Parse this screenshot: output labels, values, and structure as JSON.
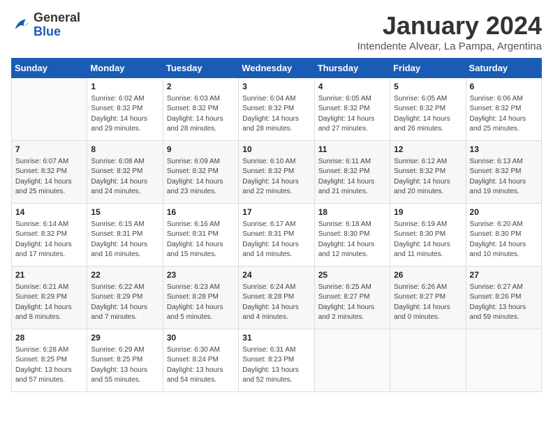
{
  "logo": {
    "general": "General",
    "blue": "Blue"
  },
  "header": {
    "title": "January 2024",
    "subtitle": "Intendente Alvear, La Pampa, Argentina"
  },
  "columns": [
    "Sunday",
    "Monday",
    "Tuesday",
    "Wednesday",
    "Thursday",
    "Friday",
    "Saturday"
  ],
  "weeks": [
    [
      {
        "day": "",
        "sunrise": "",
        "sunset": "",
        "daylight": ""
      },
      {
        "day": "1",
        "sunrise": "Sunrise: 6:02 AM",
        "sunset": "Sunset: 8:32 PM",
        "daylight": "Daylight: 14 hours and 29 minutes."
      },
      {
        "day": "2",
        "sunrise": "Sunrise: 6:03 AM",
        "sunset": "Sunset: 8:32 PM",
        "daylight": "Daylight: 14 hours and 28 minutes."
      },
      {
        "day": "3",
        "sunrise": "Sunrise: 6:04 AM",
        "sunset": "Sunset: 8:32 PM",
        "daylight": "Daylight: 14 hours and 28 minutes."
      },
      {
        "day": "4",
        "sunrise": "Sunrise: 6:05 AM",
        "sunset": "Sunset: 8:32 PM",
        "daylight": "Daylight: 14 hours and 27 minutes."
      },
      {
        "day": "5",
        "sunrise": "Sunrise: 6:05 AM",
        "sunset": "Sunset: 8:32 PM",
        "daylight": "Daylight: 14 hours and 26 minutes."
      },
      {
        "day": "6",
        "sunrise": "Sunrise: 6:06 AM",
        "sunset": "Sunset: 8:32 PM",
        "daylight": "Daylight: 14 hours and 25 minutes."
      }
    ],
    [
      {
        "day": "7",
        "sunrise": "Sunrise: 6:07 AM",
        "sunset": "Sunset: 8:32 PM",
        "daylight": "Daylight: 14 hours and 25 minutes."
      },
      {
        "day": "8",
        "sunrise": "Sunrise: 6:08 AM",
        "sunset": "Sunset: 8:32 PM",
        "daylight": "Daylight: 14 hours and 24 minutes."
      },
      {
        "day": "9",
        "sunrise": "Sunrise: 6:09 AM",
        "sunset": "Sunset: 8:32 PM",
        "daylight": "Daylight: 14 hours and 23 minutes."
      },
      {
        "day": "10",
        "sunrise": "Sunrise: 6:10 AM",
        "sunset": "Sunset: 8:32 PM",
        "daylight": "Daylight: 14 hours and 22 minutes."
      },
      {
        "day": "11",
        "sunrise": "Sunrise: 6:11 AM",
        "sunset": "Sunset: 8:32 PM",
        "daylight": "Daylight: 14 hours and 21 minutes."
      },
      {
        "day": "12",
        "sunrise": "Sunrise: 6:12 AM",
        "sunset": "Sunset: 8:32 PM",
        "daylight": "Daylight: 14 hours and 20 minutes."
      },
      {
        "day": "13",
        "sunrise": "Sunrise: 6:13 AM",
        "sunset": "Sunset: 8:32 PM",
        "daylight": "Daylight: 14 hours and 19 minutes."
      }
    ],
    [
      {
        "day": "14",
        "sunrise": "Sunrise: 6:14 AM",
        "sunset": "Sunset: 8:32 PM",
        "daylight": "Daylight: 14 hours and 17 minutes."
      },
      {
        "day": "15",
        "sunrise": "Sunrise: 6:15 AM",
        "sunset": "Sunset: 8:31 PM",
        "daylight": "Daylight: 14 hours and 16 minutes."
      },
      {
        "day": "16",
        "sunrise": "Sunrise: 6:16 AM",
        "sunset": "Sunset: 8:31 PM",
        "daylight": "Daylight: 14 hours and 15 minutes."
      },
      {
        "day": "17",
        "sunrise": "Sunrise: 6:17 AM",
        "sunset": "Sunset: 8:31 PM",
        "daylight": "Daylight: 14 hours and 14 minutes."
      },
      {
        "day": "18",
        "sunrise": "Sunrise: 6:18 AM",
        "sunset": "Sunset: 8:30 PM",
        "daylight": "Daylight: 14 hours and 12 minutes."
      },
      {
        "day": "19",
        "sunrise": "Sunrise: 6:19 AM",
        "sunset": "Sunset: 8:30 PM",
        "daylight": "Daylight: 14 hours and 11 minutes."
      },
      {
        "day": "20",
        "sunrise": "Sunrise: 6:20 AM",
        "sunset": "Sunset: 8:30 PM",
        "daylight": "Daylight: 14 hours and 10 minutes."
      }
    ],
    [
      {
        "day": "21",
        "sunrise": "Sunrise: 6:21 AM",
        "sunset": "Sunset: 8:29 PM",
        "daylight": "Daylight: 14 hours and 8 minutes."
      },
      {
        "day": "22",
        "sunrise": "Sunrise: 6:22 AM",
        "sunset": "Sunset: 8:29 PM",
        "daylight": "Daylight: 14 hours and 7 minutes."
      },
      {
        "day": "23",
        "sunrise": "Sunrise: 6:23 AM",
        "sunset": "Sunset: 8:28 PM",
        "daylight": "Daylight: 14 hours and 5 minutes."
      },
      {
        "day": "24",
        "sunrise": "Sunrise: 6:24 AM",
        "sunset": "Sunset: 8:28 PM",
        "daylight": "Daylight: 14 hours and 4 minutes."
      },
      {
        "day": "25",
        "sunrise": "Sunrise: 6:25 AM",
        "sunset": "Sunset: 8:27 PM",
        "daylight": "Daylight: 14 hours and 2 minutes."
      },
      {
        "day": "26",
        "sunrise": "Sunrise: 6:26 AM",
        "sunset": "Sunset: 8:27 PM",
        "daylight": "Daylight: 14 hours and 0 minutes."
      },
      {
        "day": "27",
        "sunrise": "Sunrise: 6:27 AM",
        "sunset": "Sunset: 8:26 PM",
        "daylight": "Daylight: 13 hours and 59 minutes."
      }
    ],
    [
      {
        "day": "28",
        "sunrise": "Sunrise: 6:28 AM",
        "sunset": "Sunset: 8:25 PM",
        "daylight": "Daylight: 13 hours and 57 minutes."
      },
      {
        "day": "29",
        "sunrise": "Sunrise: 6:29 AM",
        "sunset": "Sunset: 8:25 PM",
        "daylight": "Daylight: 13 hours and 55 minutes."
      },
      {
        "day": "30",
        "sunrise": "Sunrise: 6:30 AM",
        "sunset": "Sunset: 8:24 PM",
        "daylight": "Daylight: 13 hours and 54 minutes."
      },
      {
        "day": "31",
        "sunrise": "Sunrise: 6:31 AM",
        "sunset": "Sunset: 8:23 PM",
        "daylight": "Daylight: 13 hours and 52 minutes."
      },
      {
        "day": "",
        "sunrise": "",
        "sunset": "",
        "daylight": ""
      },
      {
        "day": "",
        "sunrise": "",
        "sunset": "",
        "daylight": ""
      },
      {
        "day": "",
        "sunrise": "",
        "sunset": "",
        "daylight": ""
      }
    ]
  ]
}
